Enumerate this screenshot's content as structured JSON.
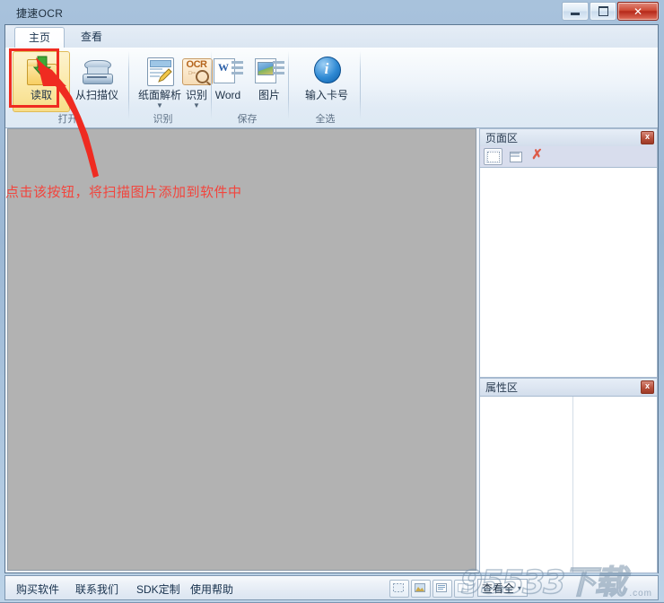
{
  "window": {
    "title": "捷速OCR",
    "buttons": {
      "minimize": "minimize",
      "maximize": "maximize",
      "close": "✕"
    }
  },
  "tabs": [
    {
      "label": "主页",
      "active": true
    },
    {
      "label": "查看",
      "active": false
    }
  ],
  "ribbon": {
    "groups": [
      {
        "label": "打开",
        "buttons": [
          {
            "label": "读取",
            "icon": "folder-open-icon",
            "selected": true,
            "caret": false
          },
          {
            "label": "从扫描仪",
            "icon": "scanner-icon",
            "selected": false,
            "caret": false
          }
        ]
      },
      {
        "label": "识别",
        "buttons": [
          {
            "label": "纸面解析",
            "icon": "page-analysis-icon",
            "selected": false,
            "caret": true
          },
          {
            "label": "识别",
            "icon": "ocr-icon",
            "selected": false,
            "caret": true
          }
        ]
      },
      {
        "label": "保存",
        "buttons": [
          {
            "label": "Word",
            "icon": "word-document-icon",
            "selected": false,
            "caret": false
          },
          {
            "label": "图片",
            "icon": "image-file-icon",
            "selected": false,
            "caret": false
          }
        ]
      },
      {
        "label": "全选",
        "buttons": [
          {
            "label": "输入卡号",
            "icon": "info-circle-icon",
            "selected": false,
            "caret": false
          }
        ]
      }
    ]
  },
  "annotation": {
    "text": "点击该按钮，将扫描图片添加到软件中",
    "color": "#f2453d",
    "highlight_target": "读取"
  },
  "panels": {
    "pages": {
      "title": "页面区",
      "close_label": "x",
      "tools": [
        {
          "name": "thumbnail-view",
          "active": true
        },
        {
          "name": "list-view",
          "active": false
        },
        {
          "name": "delete-page",
          "active": false,
          "glyph": "✗"
        }
      ]
    },
    "properties": {
      "title": "属性区",
      "close_label": "x",
      "rows": []
    }
  },
  "statusbar": {
    "links": [
      "购买软件",
      "联系我们",
      "SDK定制",
      "使用帮助"
    ],
    "view_buttons": [
      "select-region",
      "image-view",
      "text-view",
      "page-view"
    ],
    "zoom": {
      "value": "查看全",
      "caret": "▾"
    }
  },
  "watermark": {
    "main": "95533下载",
    "sub": ".com"
  },
  "colors": {
    "accent": "#2f8ad4",
    "annotation": "#f2453d",
    "ribbon_bg": "#eef4fa",
    "canvas_bg": "#b2b2b2",
    "selected_btn": "#fbe9a8",
    "title_bar": "#9bb7d4"
  }
}
